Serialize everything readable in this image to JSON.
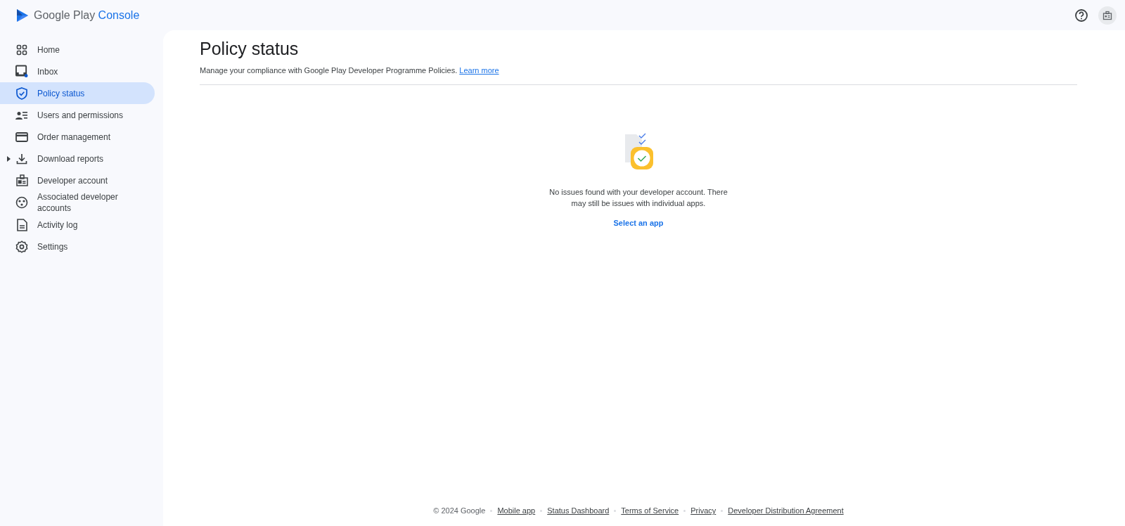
{
  "header": {
    "logo_text": "Google Play",
    "logo_accent": "Console"
  },
  "sidebar": {
    "items": [
      {
        "label": "Home",
        "selected": false
      },
      {
        "label": "Inbox",
        "selected": false,
        "unread": true
      },
      {
        "label": "Policy status",
        "selected": true
      },
      {
        "label": "Users and permissions",
        "selected": false
      },
      {
        "label": "Order management",
        "selected": false
      },
      {
        "label": "Download reports",
        "selected": false,
        "expanded": false
      },
      {
        "label": "Developer account",
        "selected": false
      },
      {
        "label": "Associated developer accounts",
        "selected": false
      },
      {
        "label": "Activity log",
        "selected": false
      },
      {
        "label": "Settings",
        "selected": false
      }
    ]
  },
  "page": {
    "title": "Policy status",
    "subtitle": "Manage your compliance with Google Play Developer Programme Policies.",
    "subtitle_link": "Learn more"
  },
  "empty_state": {
    "message": "No issues found with your developer account. There may still be issues with individual apps.",
    "action": "Select an app"
  },
  "footer": {
    "copyright": "© 2024 Google",
    "links": [
      "Mobile app",
      "Status Dashboard",
      "Terms of Service",
      "Privacy",
      "Developer Distribution Agreement"
    ]
  }
}
